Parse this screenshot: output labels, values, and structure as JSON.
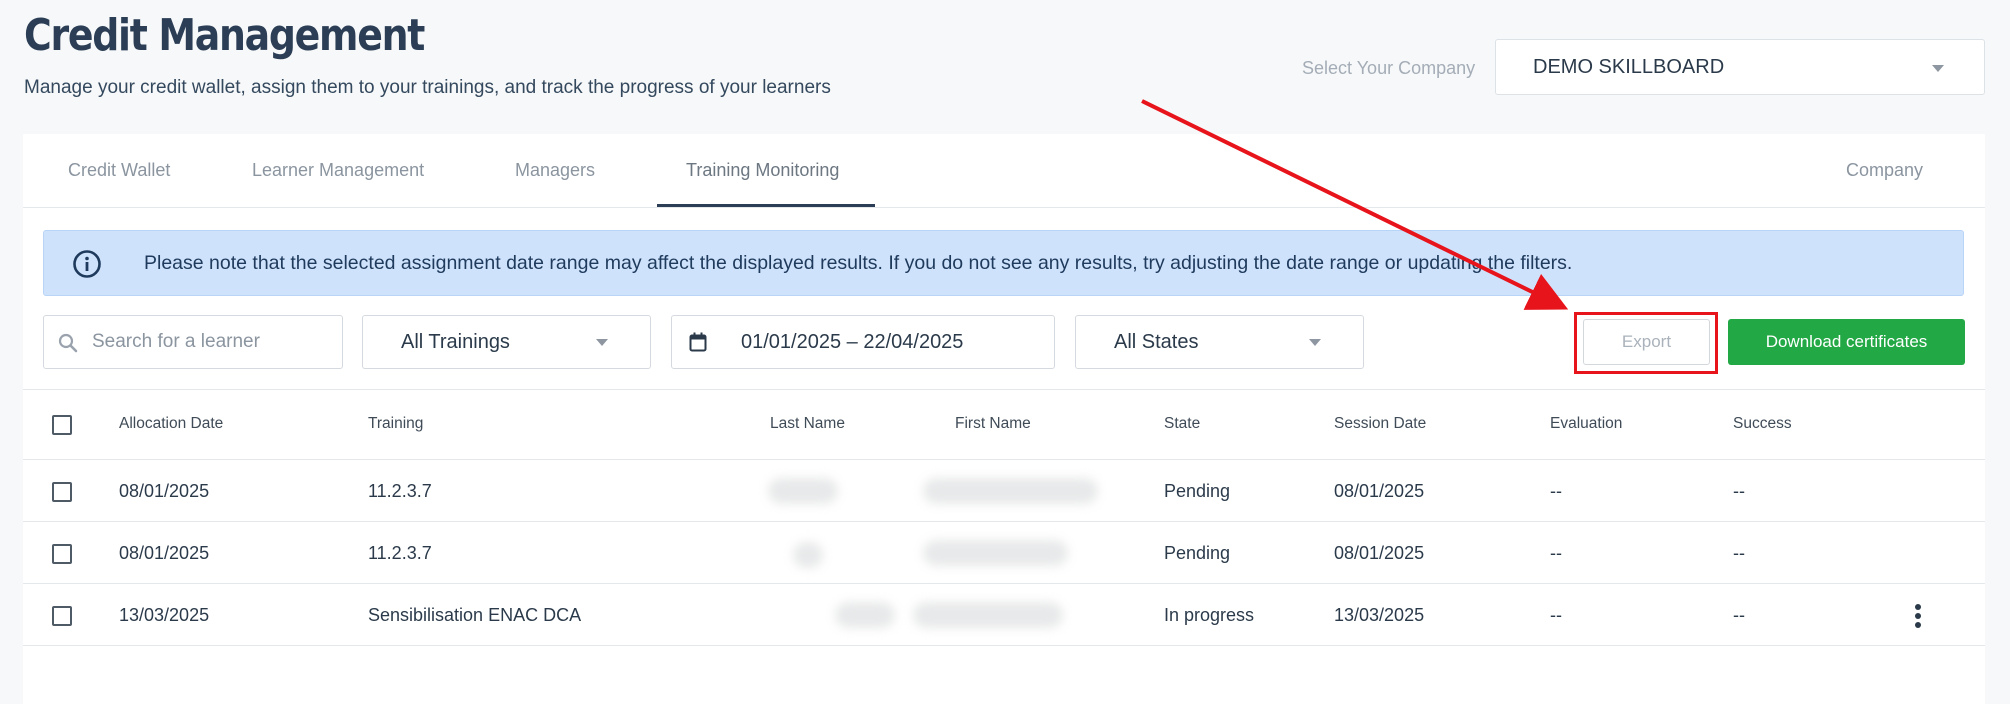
{
  "header": {
    "title": "Credit Management",
    "subtitle": "Manage your credit wallet, assign them to your trainings, and track the progress of your learners"
  },
  "company": {
    "label": "Select Your Company",
    "selected": "DEMO SKILLBOARD"
  },
  "tabs": [
    {
      "label": "Credit Wallet",
      "active": false
    },
    {
      "label": "Learner Management",
      "active": false
    },
    {
      "label": "Managers",
      "active": false
    },
    {
      "label": "Training Monitoring",
      "active": true
    },
    {
      "label": "Company",
      "active": false
    }
  ],
  "alert": {
    "icon": "info-icon",
    "message": "Please note that the selected assignment date range may affect the displayed results. If you do not see any results, try adjusting the date range or updating the filters."
  },
  "filters": {
    "search_placeholder": "Search for a learner",
    "trainings": "All Trainings",
    "date_range": "01/01/2025 – 22/04/2025",
    "states": "All States"
  },
  "actions": {
    "export": "Export",
    "download": "Download certificates"
  },
  "table": {
    "columns": [
      "Allocation Date",
      "Training",
      "Last Name",
      "First Name",
      "State",
      "Session Date",
      "Evaluation",
      "Success"
    ],
    "rows": [
      {
        "allocation_date": "08/01/2025",
        "training": "11.2.3.7",
        "state": "Pending",
        "session_date": "08/01/2025",
        "evaluation": "--",
        "success": "--"
      },
      {
        "allocation_date": "08/01/2025",
        "training": "11.2.3.7",
        "state": "Pending",
        "session_date": "08/01/2025",
        "evaluation": "--",
        "success": "--"
      },
      {
        "allocation_date": "13/03/2025",
        "training": "Sensibilisation ENAC DCA",
        "state": "In progress",
        "session_date": "13/03/2025",
        "evaluation": "--",
        "success": "--"
      }
    ]
  },
  "colors": {
    "title": "#2b3e55",
    "alert_bg": "#cfe2fb",
    "download_button": "#22a845",
    "annotation": "#e8141b"
  }
}
